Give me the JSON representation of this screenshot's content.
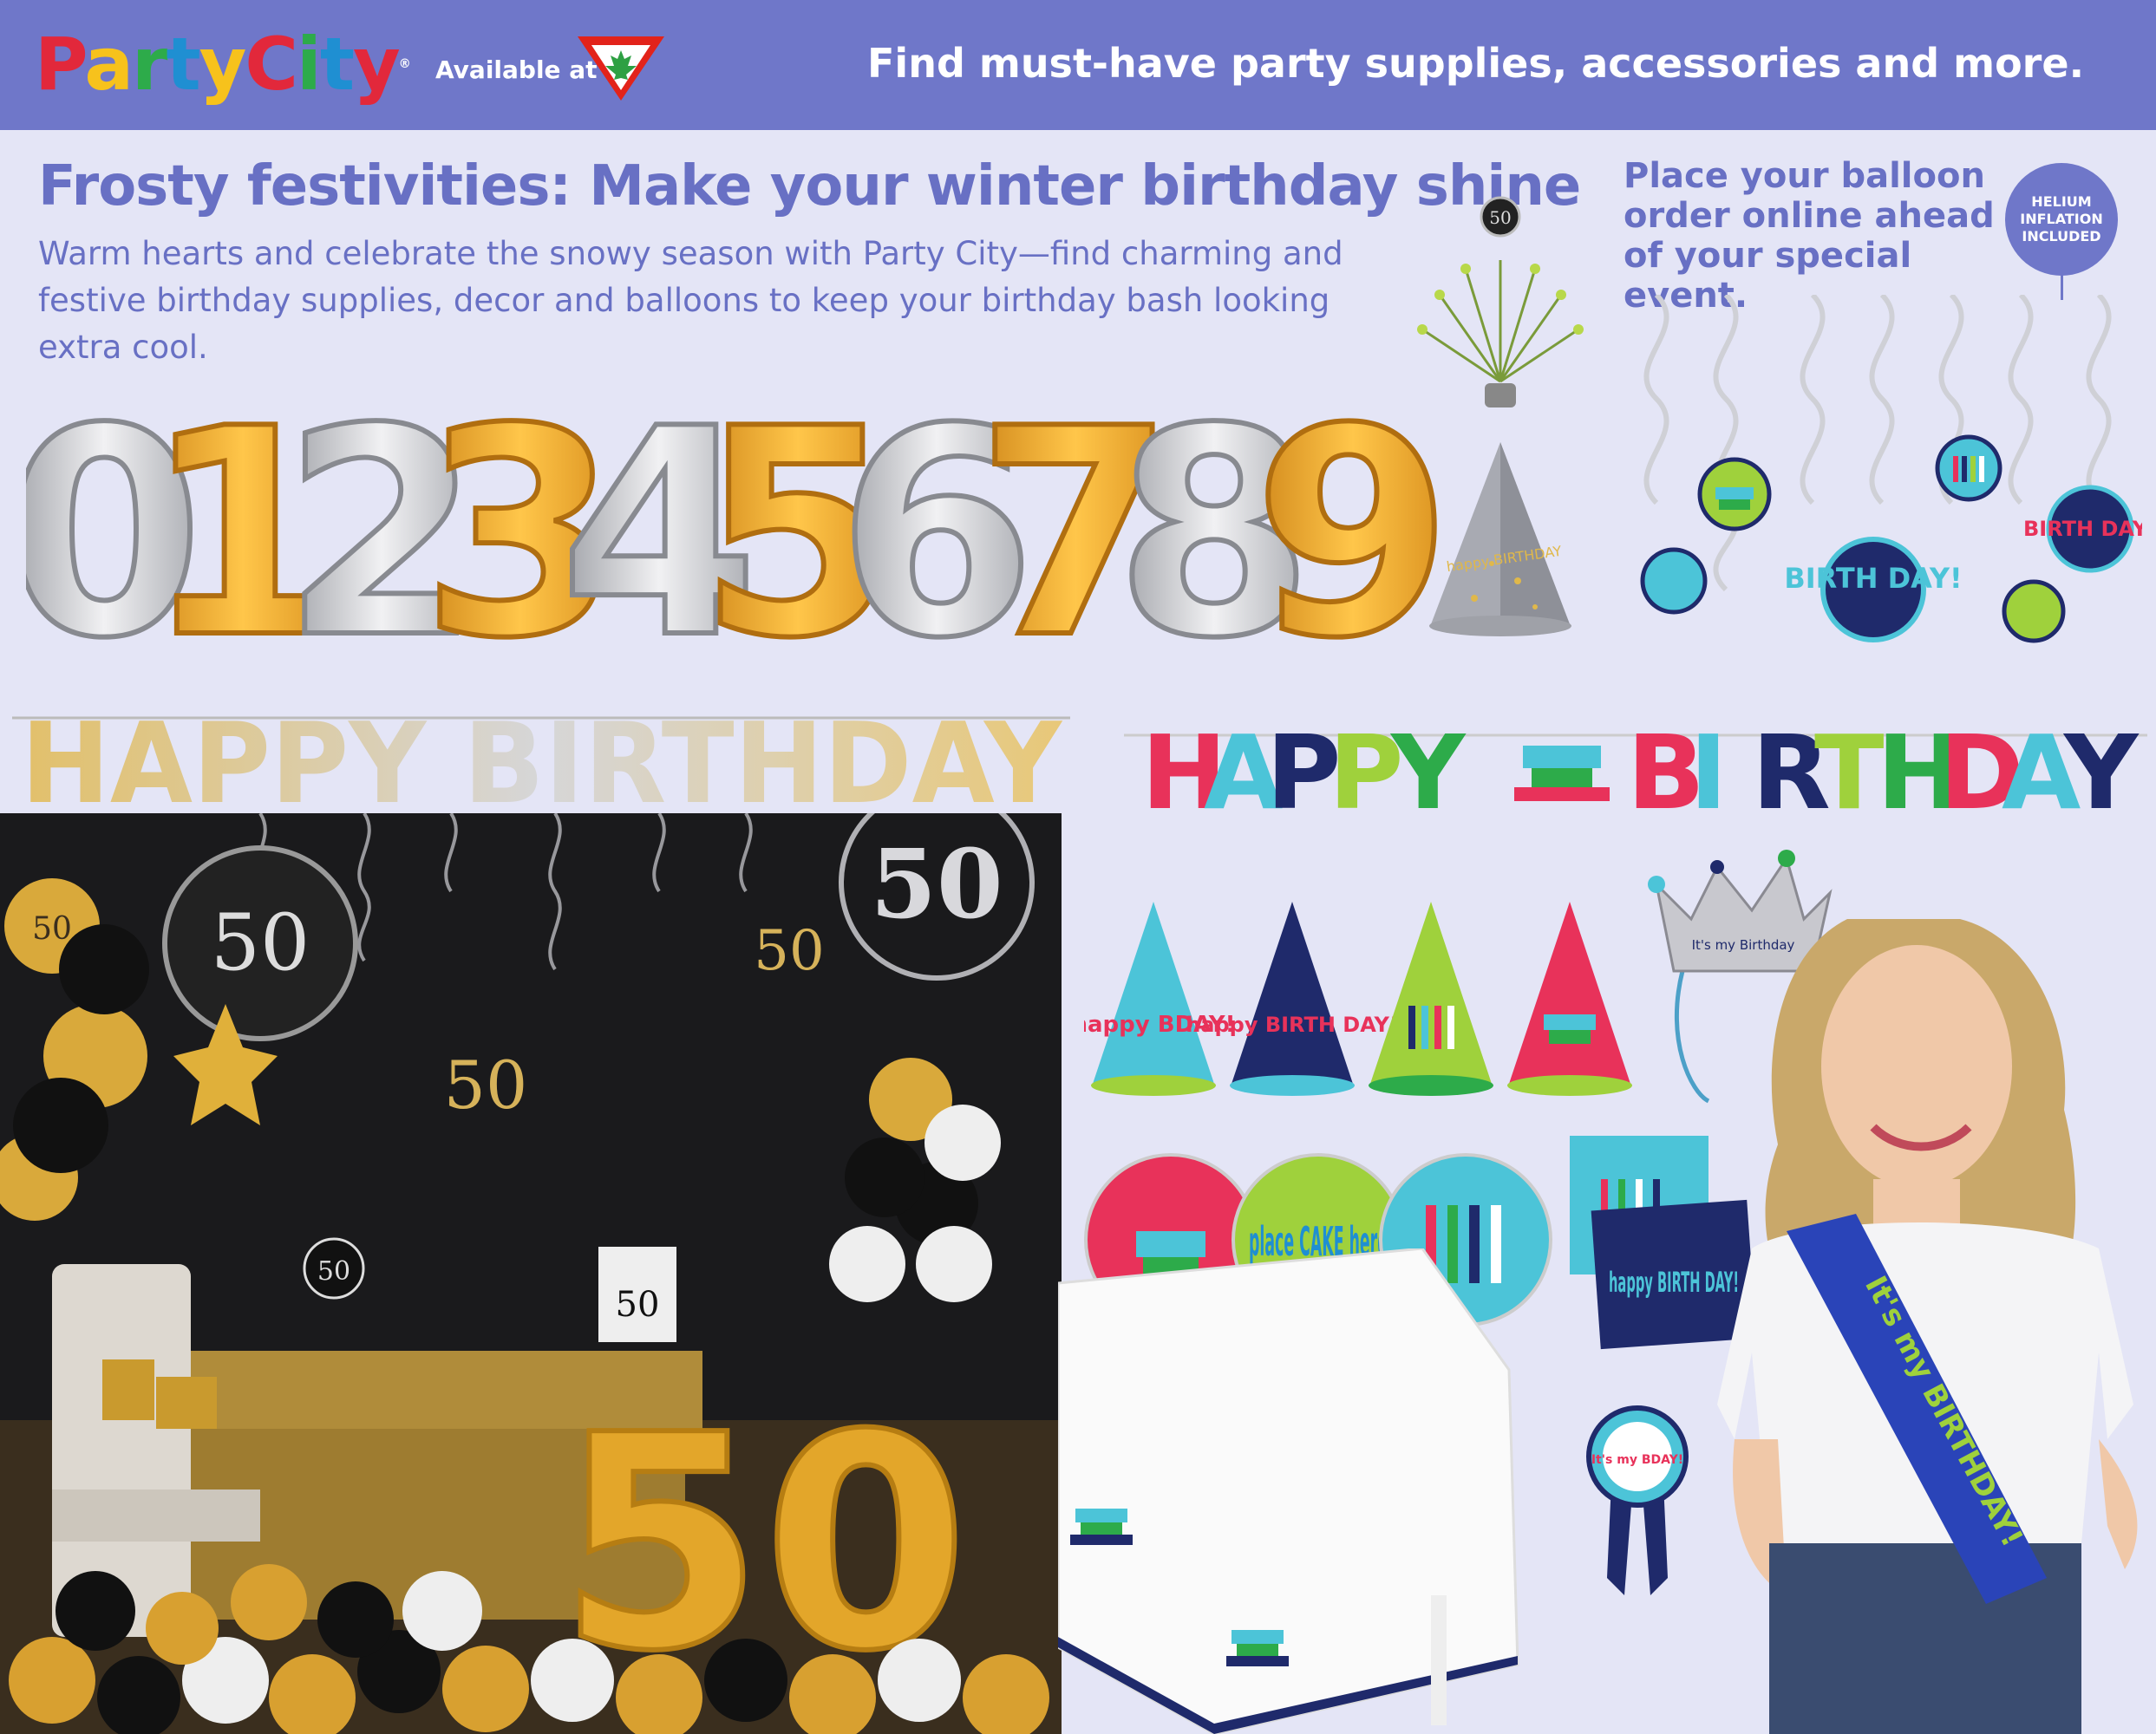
{
  "header": {
    "logo_text": "PartyCity",
    "available_label": "Available at",
    "retailer_logo": "canadian-tire-triangle-logo",
    "tagline": "Find must-have party supplies, accessories and more."
  },
  "main": {
    "title": "Frosty festivities: Make your winter birthday shine",
    "subtitle": "Warm hearts and celebrate the snowy season with Party City—find charming and festive birthday supplies, decor and balloons to keep your birthday bash looking extra cool."
  },
  "balloon_promo": {
    "text": "Place your balloon order online ahead of your special event.",
    "badge": "HELIUM INFLATION INCLUDED"
  },
  "products": {
    "number_balloons": [
      "0",
      "1",
      "2",
      "3",
      "4",
      "5",
      "6",
      "7",
      "8",
      "9"
    ],
    "gold_banner": "HAPPY BIRTHDAY",
    "color_banner": "HAPPY BIRTHDAY",
    "cone_hat_text": "happy BIRTHDAY",
    "centerpiece_number": "50",
    "swirl_texts": [
      "BIRTH DAY!",
      "BIRTH DAY!"
    ],
    "hat_texts": [
      "happy BDAY!",
      "happy BIRTH DAY!"
    ],
    "plate_texts": [
      "place CAKE here"
    ],
    "napkin_text": "happy BIRTH DAY!",
    "badge_text": "It's my BDAY!",
    "tiara_text": "It's my Birthday",
    "sash_text": "It's my BIRTHDAY!"
  },
  "party_photo": {
    "numbers": [
      "50",
      "50",
      "50",
      "50",
      "50",
      "50",
      "50"
    ],
    "big_number": "50"
  },
  "colors": {
    "header_bg": "#6f77c9",
    "page_bg": "#e4e5f6",
    "accent_text": "#6870c4",
    "gold": "#e8a623",
    "silver": "#c8c8cc",
    "navy": "#1f2a6b",
    "teal": "#4cc4d8",
    "lime": "#9fd13c",
    "pink": "#e8325a"
  }
}
